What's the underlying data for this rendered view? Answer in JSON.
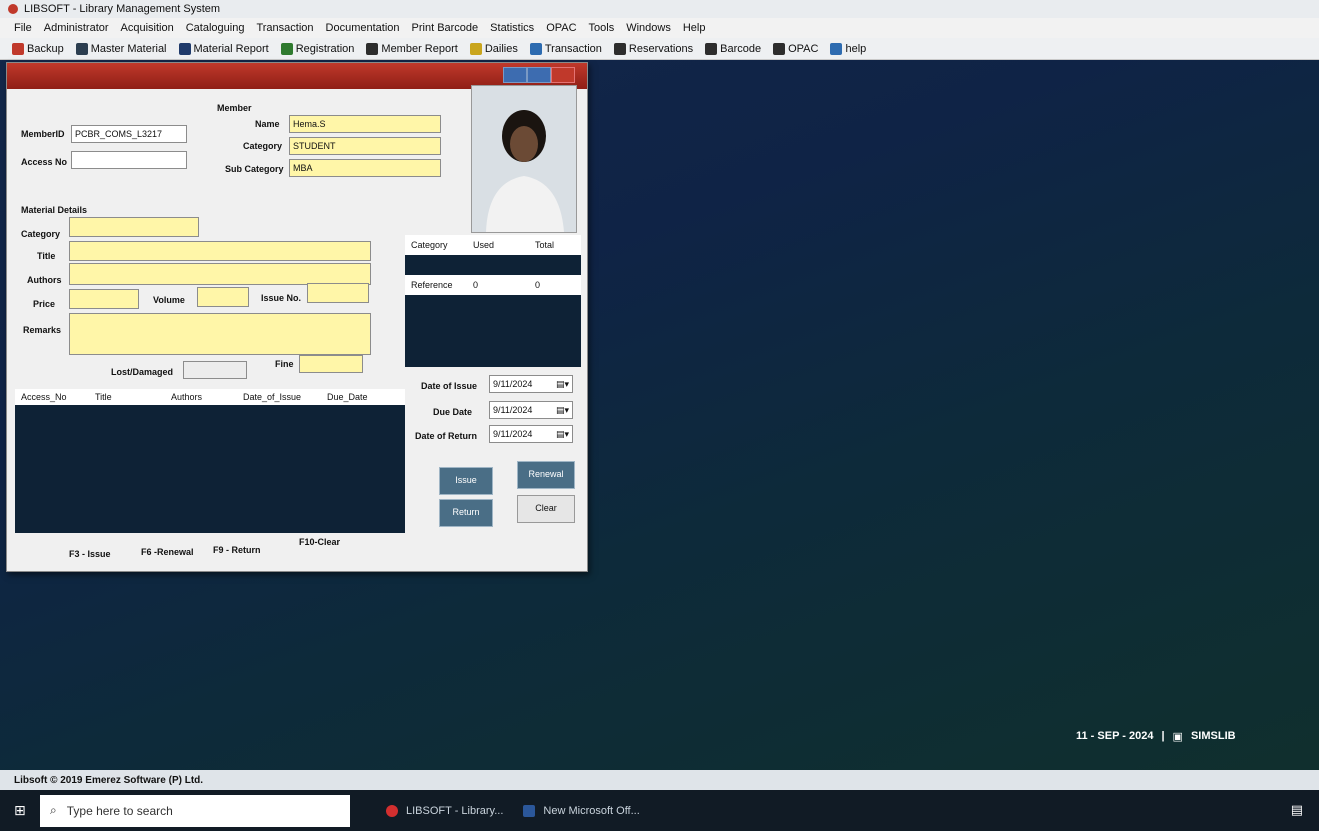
{
  "app": {
    "title": "LIBSOFT - Library Management System"
  },
  "menu": [
    "File",
    "Administrator",
    "Acquisition",
    "Cataloguing",
    "Transaction",
    "Documentation",
    "Print Barcode",
    "Statistics",
    "OPAC",
    "Tools",
    "Windows",
    "Help"
  ],
  "toolbar": [
    {
      "label": "Backup",
      "icon": "backup-icon",
      "color": "#c0392b"
    },
    {
      "label": "Master Material",
      "icon": "master-material-icon",
      "color": "#2c3e50"
    },
    {
      "label": "Material Report",
      "icon": "material-report-icon",
      "color": "#1f3a6b"
    },
    {
      "label": "Registration",
      "icon": "registration-icon",
      "color": "#2f7a2f"
    },
    {
      "label": "Member Report",
      "icon": "member-report-icon",
      "color": "#2d2d2d"
    },
    {
      "label": "Dailies",
      "icon": "dailies-icon",
      "color": "#c9a51d"
    },
    {
      "label": "Transaction",
      "icon": "transaction-icon",
      "color": "#2d6bb0"
    },
    {
      "label": "Reservations",
      "icon": "reservations-icon",
      "color": "#2d2d2d"
    },
    {
      "label": "Barcode",
      "icon": "barcode-icon",
      "color": "#2d2d2d"
    },
    {
      "label": "OPAC",
      "icon": "opac-icon",
      "color": "#2d2d2d"
    },
    {
      "label": "help",
      "icon": "help-icon",
      "color": "#2d6bb0"
    }
  ],
  "dialog": {
    "member_label": "Member",
    "member_id_label": "MemberID",
    "member_id": "PCBR_COMS_L3217",
    "access_no_label": "Access No",
    "access_no": "",
    "name_label": "Name",
    "name": "Hema.S",
    "category_label": "Category",
    "category": "STUDENT",
    "sub_category_label": "Sub Category",
    "sub_category": "MBA",
    "material_details_label": "Material Details",
    "mat_category_label": "Category",
    "title_label": "Title",
    "authors_label": "Authors",
    "price_label": "Price",
    "volume_label": "Volume",
    "issue_no_label": "Issue No.",
    "remarks_label": "Remarks",
    "lost_damaged_label": "Lost/Damaged",
    "fine_label": "Fine",
    "cat_grid": {
      "headers": [
        "Category",
        "Used",
        "Total"
      ],
      "rows": [
        [
          "Reference",
          "0",
          "0"
        ]
      ]
    },
    "tx_grid": {
      "headers": [
        "Access_No",
        "Title",
        "Authors",
        "Date_of_Issue",
        "Due_Date"
      ]
    },
    "date_of_issue_label": "Date of Issue",
    "date_of_issue": "9/11/2024",
    "due_date_label": "Due Date",
    "due_date": "9/11/2024",
    "date_of_return_label": "Date of Return",
    "date_of_return": "9/11/2024",
    "buttons": {
      "issue": "Issue",
      "renewal": "Renewal",
      "return": "Return",
      "clear": "Clear"
    },
    "shortcuts": [
      "F3 - Issue",
      "F6 -Renewal",
      "F9 - Return",
      "F10-Clear"
    ]
  },
  "status": {
    "copyright": "Libsoft © 2019 Emerez Software (P) Ltd.",
    "date": "11 - SEP - 2024",
    "app": "SIMSLIB"
  },
  "taskbar": {
    "search_placeholder": "Type here to search",
    "task1": "LIBSOFT - Library...",
    "task2": "New Microsoft Off..."
  }
}
